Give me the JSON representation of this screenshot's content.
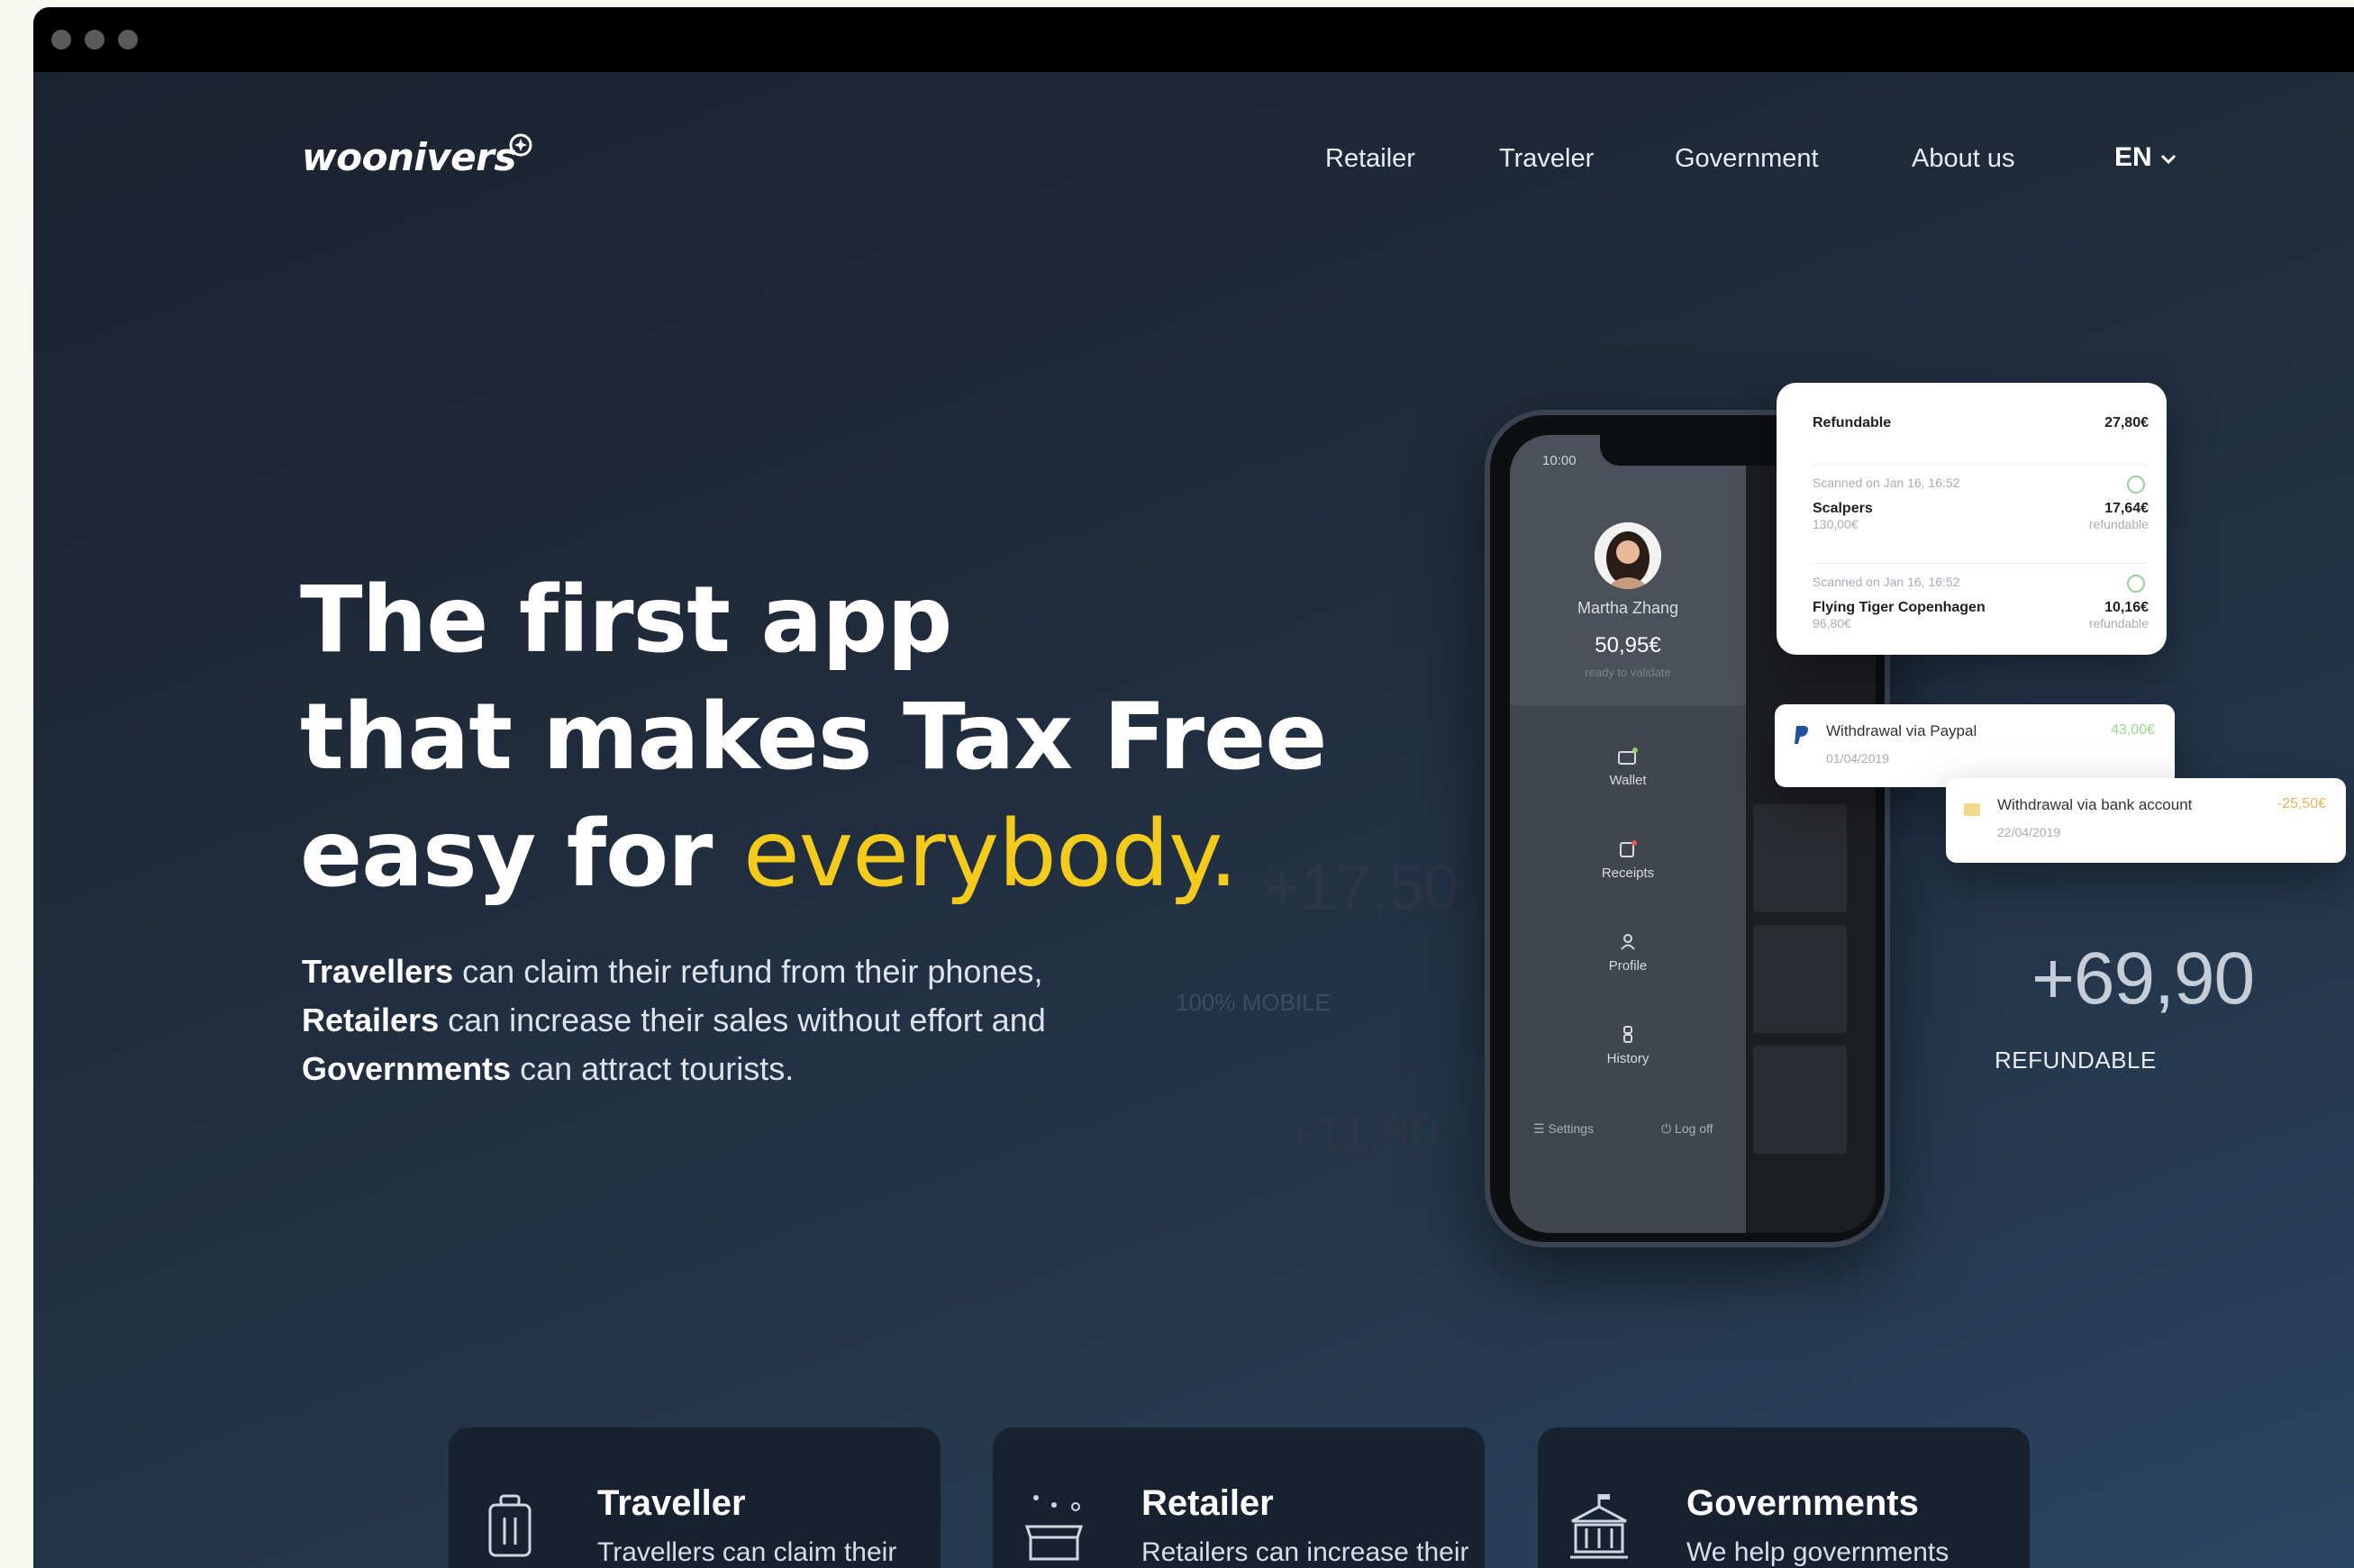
{
  "brand": {
    "logo_text": "woonivers"
  },
  "nav": {
    "items": [
      "Retailer",
      "Traveler",
      "Government",
      "About us"
    ],
    "language": "EN"
  },
  "hero": {
    "line1": "The first app",
    "line2": "that makes Tax Free",
    "line3_prefix": "easy for ",
    "line3_accent": "everybody.",
    "sub": [
      {
        "bold": "Travellers",
        "text": " can claim their refund from their phones,"
      },
      {
        "bold": "Retailers",
        "text": " can increase their sales without effort and"
      },
      {
        "bold": "Governments",
        "text": " can attract tourists."
      }
    ]
  },
  "stats": {
    "ghost_1": "+17,50",
    "ghost_2": "+11,80",
    "ghost_label": "100% MOBILE",
    "refundable_amount": "+69,90",
    "refundable_label": "REFUNDABLE"
  },
  "phone": {
    "status_time": "10:00",
    "user_name": "Martha Zhang",
    "balance": "50,95€",
    "balance_note": "ready to validate",
    "menu": [
      "Wallet",
      "Receipts",
      "Profile",
      "History"
    ],
    "footer": {
      "settings": "Settings",
      "logoff": "Log off"
    }
  },
  "refund_card": {
    "header_label": "Refundable",
    "header_amount": "27,80€",
    "items": [
      {
        "scanned": "Scanned on Jan 16, 16:52",
        "store": "Scalpers",
        "price": "130,00€",
        "refund": "17,64€",
        "refund_note": "refundable"
      },
      {
        "scanned": "Scanned on Jan 16, 16:52",
        "store": "Flying Tiger Copenhagen",
        "price": "96,80€",
        "refund": "10,16€",
        "refund_note": "refundable"
      }
    ]
  },
  "withdrawals": [
    {
      "title": "Withdrawal via Paypal",
      "date": "01/04/2019",
      "amount": "43,00€"
    },
    {
      "title": "Withdrawal via bank account",
      "date": "22/04/2019",
      "amount": "-25,50€"
    }
  ],
  "features": [
    {
      "title": "Traveller",
      "text": "Travellers can claim their",
      "icon": "luggage-icon"
    },
    {
      "title": "Retailer",
      "text": "Retailers can increase their",
      "icon": "store-icon"
    },
    {
      "title": "Governments",
      "text": "We help governments",
      "icon": "government-building-icon"
    }
  ],
  "colors": {
    "accent": "#f4cb1c",
    "background": "#1f2a3a",
    "card": "#172130"
  }
}
